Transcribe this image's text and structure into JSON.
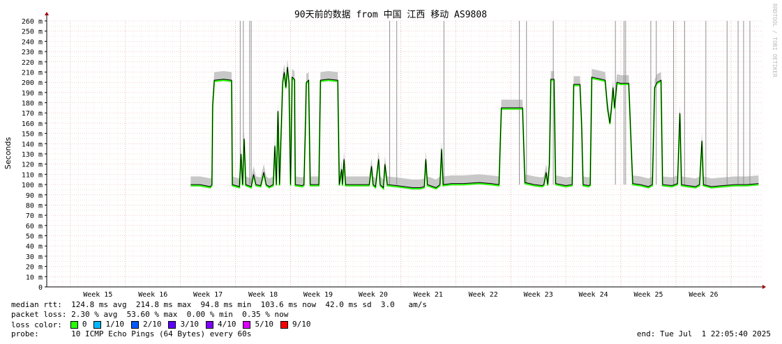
{
  "chart_data": {
    "type": "line",
    "title": "90天前的数据 from 中国 江西 移动 AS9808",
    "ylabel": "Seconds",
    "watermark": "RRDTOOL / TOBI OETIKER",
    "ylim": [
      0,
      260
    ],
    "yticks": [
      "0",
      "10 m",
      "20 m",
      "30 m",
      "40 m",
      "50 m",
      "60 m",
      "70 m",
      "80 m",
      "90 m",
      "100 m",
      "110 m",
      "120 m",
      "130 m",
      "140 m",
      "150 m",
      "160 m",
      "170 m",
      "180 m",
      "190 m",
      "200 m",
      "210 m",
      "220 m",
      "230 m",
      "240 m",
      "250 m",
      "260 m"
    ],
    "xticks": [
      "Week 15",
      "Week 16",
      "Week 17",
      "Week 18",
      "Week 19",
      "Week 20",
      "Week 21",
      "Week 22",
      "Week 23",
      "Week 24",
      "Week 25",
      "Week 26"
    ],
    "grid": true,
    "x_unit": "days since graph start",
    "x_range": [
      0,
      91
    ],
    "series": [
      {
        "name": "median rtt",
        "color": "#000000",
        "points": [
          [
            18.3,
            100
          ],
          [
            19.5,
            100
          ],
          [
            20.8,
            98
          ],
          [
            21.0,
            100
          ],
          [
            21.1,
            178
          ],
          [
            21.3,
            202
          ],
          [
            22.5,
            203
          ],
          [
            23.5,
            202
          ],
          [
            23.6,
            100
          ],
          [
            24.5,
            98
          ],
          [
            24.7,
            130
          ],
          [
            24.9,
            100
          ],
          [
            25.1,
            145
          ],
          [
            25.3,
            100
          ],
          [
            26.0,
            98
          ],
          [
            26.3,
            110
          ],
          [
            26.6,
            100
          ],
          [
            27.2,
            99
          ],
          [
            27.6,
            112
          ],
          [
            27.9,
            100
          ],
          [
            28.3,
            98
          ],
          [
            28.8,
            100
          ],
          [
            29.0,
            138
          ],
          [
            29.2,
            100
          ],
          [
            29.4,
            172
          ],
          [
            29.6,
            100
          ],
          [
            30.0,
            200
          ],
          [
            30.2,
            210
          ],
          [
            30.4,
            195
          ],
          [
            30.6,
            215
          ],
          [
            30.8,
            200
          ],
          [
            31.0,
            100
          ],
          [
            31.2,
            205
          ],
          [
            31.5,
            203
          ],
          [
            31.6,
            100
          ],
          [
            32.5,
            99
          ],
          [
            32.7,
            100
          ],
          [
            32.9,
            160
          ],
          [
            33.0,
            200
          ],
          [
            33.3,
            202
          ],
          [
            33.5,
            100
          ],
          [
            34.6,
            100
          ],
          [
            34.8,
            202
          ],
          [
            35.8,
            203
          ],
          [
            37.0,
            202
          ],
          [
            37.2,
            100
          ],
          [
            37.5,
            115
          ],
          [
            37.6,
            100
          ],
          [
            37.8,
            125
          ],
          [
            38.0,
            100
          ],
          [
            39.5,
            100
          ],
          [
            41.0,
            100
          ],
          [
            41.3,
            118
          ],
          [
            41.5,
            100
          ],
          [
            41.8,
            98
          ],
          [
            42.2,
            125
          ],
          [
            42.4,
            100
          ],
          [
            42.8,
            97
          ],
          [
            43.0,
            120
          ],
          [
            43.3,
            100
          ],
          [
            44.5,
            99
          ],
          [
            45.5,
            98
          ],
          [
            46.5,
            97
          ],
          [
            47.5,
            97
          ],
          [
            48.0,
            98
          ],
          [
            48.2,
            125
          ],
          [
            48.4,
            100
          ],
          [
            49.5,
            97
          ],
          [
            50.0,
            100
          ],
          [
            50.2,
            135
          ],
          [
            50.4,
            100
          ],
          [
            51.5,
            101
          ],
          [
            53.0,
            101
          ],
          [
            55.0,
            102
          ],
          [
            56.5,
            101
          ],
          [
            57.5,
            100
          ],
          [
            57.8,
            175
          ],
          [
            59.0,
            175
          ],
          [
            60.5,
            175
          ],
          [
            60.8,
            102
          ],
          [
            62.0,
            100
          ],
          [
            63.0,
            99
          ],
          [
            63.2,
            100
          ],
          [
            63.5,
            112
          ],
          [
            63.7,
            100
          ],
          [
            63.9,
            120
          ],
          [
            64.1,
            203
          ],
          [
            64.5,
            203
          ],
          [
            64.7,
            101
          ],
          [
            66.0,
            99
          ],
          [
            66.8,
            100
          ],
          [
            67.0,
            198
          ],
          [
            67.8,
            198
          ],
          [
            68.0,
            160
          ],
          [
            68.2,
            100
          ],
          [
            68.9,
            99
          ],
          [
            69.1,
            100
          ],
          [
            69.3,
            205
          ],
          [
            70.5,
            203
          ],
          [
            71.0,
            202
          ],
          [
            71.3,
            175
          ],
          [
            71.6,
            160
          ],
          [
            71.8,
            175
          ],
          [
            72.0,
            195
          ],
          [
            72.2,
            175
          ],
          [
            72.5,
            200
          ],
          [
            73.0,
            199
          ],
          [
            74.0,
            199
          ],
          [
            74.5,
            101
          ],
          [
            75.5,
            100
          ],
          [
            76.5,
            98
          ],
          [
            77.0,
            100
          ],
          [
            77.3,
            195
          ],
          [
            77.6,
            200
          ],
          [
            78.1,
            202
          ],
          [
            78.3,
            100
          ],
          [
            79.5,
            99
          ],
          [
            80.2,
            101
          ],
          [
            80.5,
            170
          ],
          [
            80.7,
            100
          ],
          [
            81.5,
            99
          ],
          [
            82.5,
            98
          ],
          [
            83.0,
            100
          ],
          [
            83.3,
            143
          ],
          [
            83.5,
            100
          ],
          [
            84.5,
            98
          ],
          [
            86.0,
            99
          ],
          [
            87.5,
            100
          ],
          [
            89.0,
            100
          ],
          [
            90.5,
            101
          ]
        ]
      }
    ],
    "loss_spikes_days": [
      24.6,
      25.0,
      25.8,
      26.0,
      43.6,
      44.5,
      50.5,
      60.1,
      61.0,
      64.4,
      72.3,
      73.4,
      73.6,
      76.8,
      77.5,
      79.7,
      81.1,
      83.8,
      86.5,
      87.9,
      88.6,
      89.4
    ],
    "stats": {
      "median_rtt_label": "median rtt:",
      "median_rtt_values": "124.8 ms avg  214.8 ms max  94.8 ms min  103.6 ms now  42.0 ms sd  3.0   am/s",
      "packet_loss_label": "packet loss:",
      "packet_loss_values": "2.30 % avg  53.60 % max  0.00 % min  0.35 % now",
      "loss_color_label": "loss color:",
      "loss_colors": [
        {
          "label": "0",
          "color": "#26ff00"
        },
        {
          "label": "1/10",
          "color": "#00b8ff"
        },
        {
          "label": "2/10",
          "color": "#0059ff"
        },
        {
          "label": "3/10",
          "color": "#5e00ff"
        },
        {
          "label": "4/10",
          "color": "#7e00ff"
        },
        {
          "label": "5/10",
          "color": "#dd00ff"
        },
        {
          "label": "9/10",
          "color": "#ff0000"
        }
      ],
      "probe_label": "probe:",
      "probe_value": "10 ICMP Echo Pings (64 Bytes) every 60s",
      "end_label": "end:",
      "end_value": "Tue Jul  1 22:05:40 2025"
    }
  }
}
